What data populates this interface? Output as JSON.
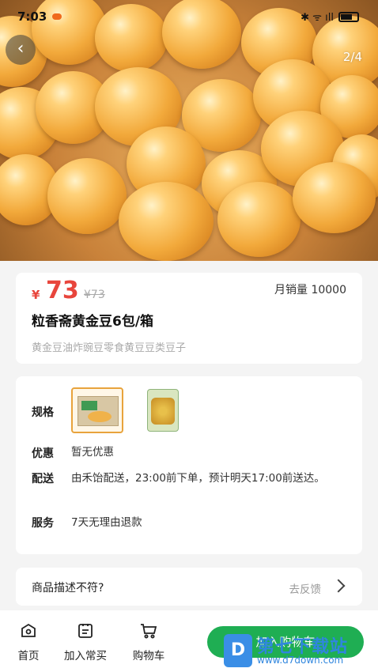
{
  "status_bar": {
    "time": "7:03",
    "icons_text": "✱ ᯤ ıll"
  },
  "gallery": {
    "counter": "2/4",
    "back_glyph": "‹"
  },
  "product": {
    "currency_symbol": "¥",
    "price": "73",
    "original_price": "¥73",
    "monthly_sales": "月销量 10000",
    "title": "粒香斋黄金豆6包/箱",
    "subtitle": "黄金豆油炸豌豆零食黄豆豆类豆子"
  },
  "specs": {
    "spec_label": "规格",
    "promo_label": "优惠",
    "promo_value": "暂无优惠",
    "delivery_label": "配送",
    "delivery_value": "由禾饴配送，23:00前下单，预计明天17:00前送达。",
    "service_label": "服务",
    "service_value": "7天无理由退款"
  },
  "feedback": {
    "label": "商品描述不符?",
    "link": "去反馈"
  },
  "bottom_bar": {
    "home_label": "首页",
    "add_regular_label": "加入常买",
    "cart_label": "购物车",
    "add_to_cart_label": "加入购物车"
  },
  "watermark": {
    "logo_letter": "D",
    "title": "第七下载站",
    "url": "www.d7down.com"
  },
  "colors": {
    "price": "#e8453c",
    "accent_green": "#1fae53",
    "selected_border": "#e8a33c"
  }
}
